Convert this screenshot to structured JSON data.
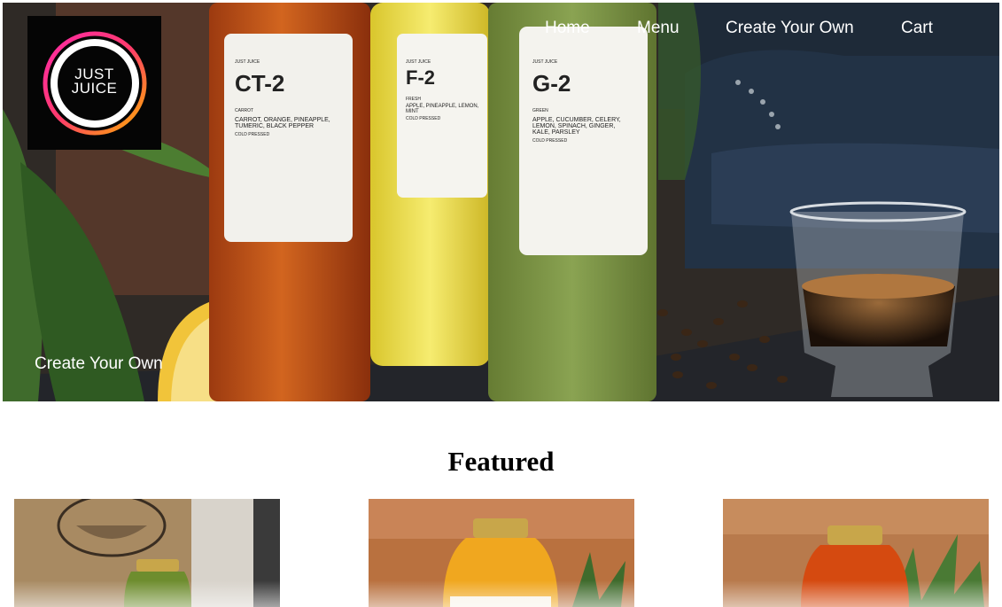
{
  "brand": {
    "logo_line1": "JUST",
    "logo_line2": "JUICE"
  },
  "nav": {
    "home": "Home",
    "menu": "Menu",
    "create": "Create Your Own",
    "cart": "Cart"
  },
  "hero": {
    "cta": "Create Your Own",
    "bottles": [
      {
        "brand": "JUST JUICE",
        "code": "CT-2",
        "kind": "CARROT",
        "ingredients_1": "CARROT, ORANGE, PINEAPPLE,",
        "ingredients_2": "TUMERIC, BLACK PEPPER",
        "note": "COLD PRESSED"
      },
      {
        "brand": "JUST JUICE",
        "code": "F-2",
        "kind": "FRESH",
        "ingredients_1": "APPLE, PINEAPPLE, LEMON,",
        "ingredients_2": "MINT",
        "note": "COLD PRESSED"
      },
      {
        "brand": "JUST JUICE",
        "code": "G-2",
        "kind": "GREEN",
        "ingredients_1": "APPLE, CUCUMBER, CELERY,",
        "ingredients_2": "LEMON, SPINACH, GINGER,",
        "ingredients_3": "KALE, PARSLEY",
        "note": "COLD PRESSED"
      }
    ]
  },
  "featured": {
    "title": "Featured"
  },
  "colors": {
    "logo_ring_start": "#ff2aa8",
    "logo_ring_end": "#ffb000",
    "carrot_juice": "#c4541a",
    "fresh_juice": "#f2e24a",
    "green_juice": "#7f9a48",
    "nav_text": "#ffffff"
  },
  "icons": {
    "logo": "just-juice-logo-icon"
  }
}
